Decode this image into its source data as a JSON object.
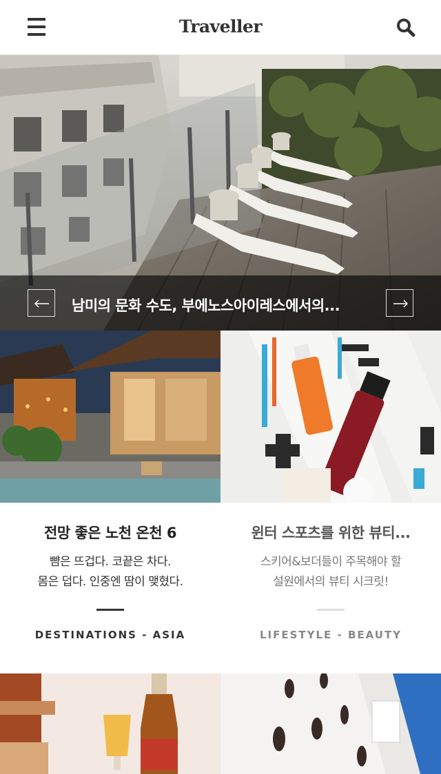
{
  "header": {
    "logo": "Traveller",
    "menu_icon": "hamburger-menu-icon",
    "search_icon": "search-icon"
  },
  "hero": {
    "title": "남미의 문화 수도, 부에노스아이레스에서의...",
    "prev_icon": "arrow-left-icon",
    "next_icon": "arrow-right-icon"
  },
  "cards": [
    {
      "title": "전망 좋은 노천 온천 6",
      "desc_lines": [
        "뺨은 뜨겁다. 코끝은 차다.",
        "몸은 덥다. 인중엔 땀이 맺혔다."
      ],
      "category": "DESTINATIONS - ASIA"
    },
    {
      "title": "윈터 스포츠를 위한 뷰티...",
      "desc_lines": [
        "스키어&보더들이 주목해야 할",
        "설원에서의 뷰티 시크릿!"
      ],
      "category": "LIFESTYLE - BEAUTY"
    }
  ],
  "colors": {
    "accent_dark": "#333333",
    "caption_bg": "rgba(0,0,0,0.62)",
    "muted_rule": "#dddddd"
  }
}
